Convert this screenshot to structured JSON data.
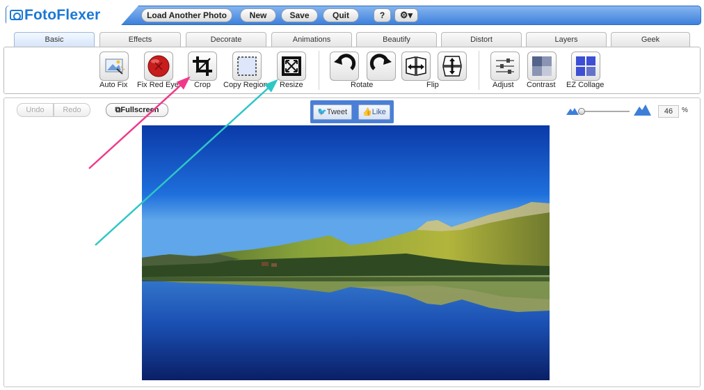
{
  "app": {
    "title": "FotoFlexer"
  },
  "topbar": {
    "load_another": "Load Another Photo",
    "new": "New",
    "save": "Save",
    "quit": "Quit",
    "help": "?",
    "settings_icon": "gear-icon"
  },
  "tabs": [
    "Basic",
    "Effects",
    "Decorate",
    "Animations",
    "Beautify",
    "Distort",
    "Layers",
    "Geek"
  ],
  "active_tab": "Basic",
  "tools": {
    "auto_fix": "Auto Fix",
    "fix_red_eye": "Fix Red Eye",
    "crop": "Crop",
    "copy_region": "Copy Region",
    "resize": "Resize",
    "rotate": "Rotate",
    "flip": "Flip",
    "adjust": "Adjust",
    "contrast": "Contrast",
    "ez_collage": "EZ Collage"
  },
  "edit": {
    "undo": "Undo",
    "redo": "Redo",
    "fullscreen": "Fullscreen"
  },
  "social": {
    "tweet": "Tweet",
    "like": "Like"
  },
  "zoom": {
    "value": "46",
    "unit": "%"
  },
  "annotations": {
    "arrow_pink_color": "#f0398a",
    "arrow_teal_color": "#2fc6c6"
  }
}
